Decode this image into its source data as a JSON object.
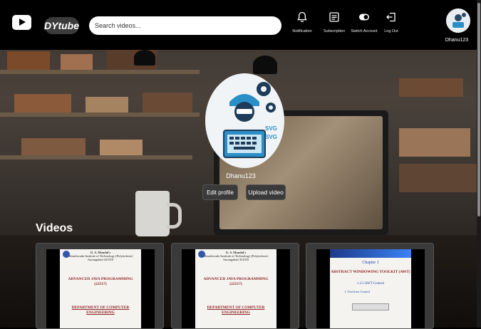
{
  "header": {
    "brand": "DYtube",
    "search_placeholder": "Search videos...",
    "nav": [
      {
        "label": "Notification",
        "icon": "bell-icon"
      },
      {
        "label": "Subscription",
        "icon": "subscription-icon"
      },
      {
        "label": "Switch Account",
        "icon": "toggle-icon"
      },
      {
        "label": "Log Out",
        "icon": "logout-icon"
      }
    ],
    "username": "Dhanu123"
  },
  "channel": {
    "name": "Dhanu123",
    "avatar_text": "SVG",
    "edit_label": "Edit profile",
    "upload_label": "Upload video"
  },
  "videos": {
    "title": "Videos",
    "items": [
      {
        "institute": "G. S. Mandal's",
        "college": "Marathwada Institute of Technology (Polytechnic)",
        "city": "Aurangabad 431010",
        "course": "ADVANCED JAVA PROGRAMMING (22517)",
        "dept": "DEPARTMENT OF COMPUTER ENGINEERING"
      },
      {
        "institute": "G. S. Mandal's",
        "college": "Marathwada Institute of Technology (Polytechnic)",
        "city": "Aurangabad 431010",
        "course": "ADVANCED JAVA PROGRAMMING (22517)",
        "dept": "DEPARTMENT OF COMPUTER ENGINEERING"
      },
      {
        "chapter": "Chapter 1",
        "topic": "ABSTRACT WINDOWING TOOLKIT (AWT)",
        "section": "1.3.5 AWT Control",
        "item": "1. TextArea Control"
      }
    ]
  },
  "colors": {
    "header_bg": "#000000",
    "button_bg": "#3a3a3a",
    "card_bg": "#3a3a3a"
  }
}
